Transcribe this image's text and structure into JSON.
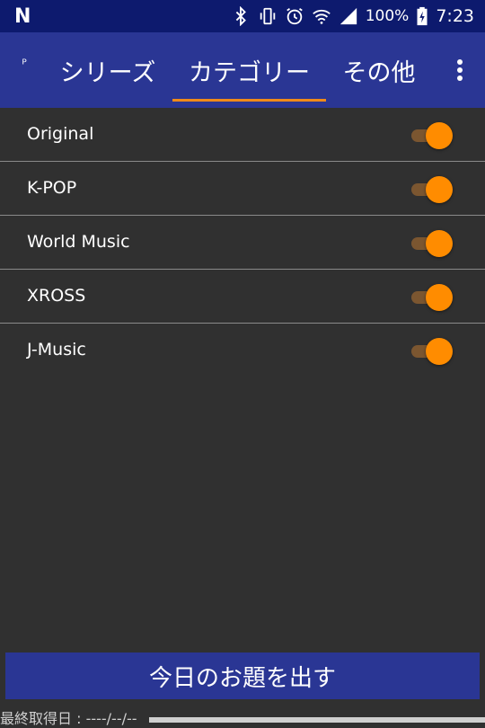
{
  "status_bar": {
    "notification_icon": "n-icon",
    "battery": "100%",
    "time": "7:23",
    "icons": [
      "bluetooth-icon",
      "vibrate-icon",
      "alarm-icon",
      "wifi-icon",
      "signal-icon",
      "battery-charging-icon"
    ]
  },
  "app_bar": {
    "partial_tab": "ᴾ",
    "tabs": [
      {
        "label": "シリーズ",
        "selected": false
      },
      {
        "label": "カテゴリー",
        "selected": true
      },
      {
        "label": "その他",
        "selected": false
      }
    ],
    "overflow_icon": "more-vert-icon",
    "indicator_color": "#ef8a1a"
  },
  "categories": [
    {
      "label": "Original",
      "enabled": true
    },
    {
      "label": "K-POP",
      "enabled": true
    },
    {
      "label": "World Music",
      "enabled": true
    },
    {
      "label": "XROSS",
      "enabled": true
    },
    {
      "label": "J-Music",
      "enabled": true
    }
  ],
  "main_button": {
    "label": "今日のお題を出す"
  },
  "footer": {
    "last_fetch_label": "最終取得日 : ----/--/--"
  },
  "colors": {
    "accent": "#ff8c00",
    "app_bar": "#2a3694",
    "status_bar": "#0d1a6e",
    "background": "#303030"
  }
}
